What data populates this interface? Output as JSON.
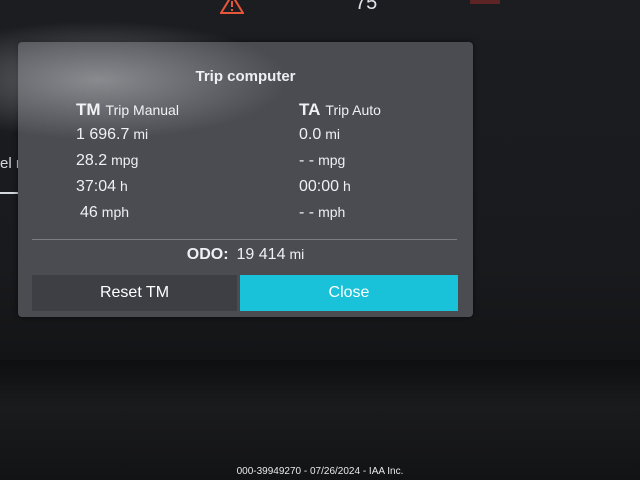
{
  "dashboard": {
    "top_number": "75",
    "side_text": "el ra"
  },
  "trip_computer": {
    "title": "Trip computer",
    "trip_manual": {
      "abbr": "TM",
      "label": "Trip Manual",
      "distance": {
        "value": "1 696.7",
        "unit": "mi"
      },
      "economy": {
        "value": "28.2",
        "unit": "mpg"
      },
      "time": {
        "value": "37:04",
        "unit": "h"
      },
      "speed": {
        "value": "46",
        "unit": "mph"
      }
    },
    "trip_auto": {
      "abbr": "TA",
      "label": "Trip Auto",
      "distance": {
        "value": "0.0",
        "unit": "mi"
      },
      "economy": {
        "value": "- -",
        "unit": "mpg"
      },
      "time": {
        "value": "00:00",
        "unit": "h"
      },
      "speed": {
        "value": "- -",
        "unit": "mph"
      }
    },
    "odometer": {
      "label": "ODO:",
      "value": "19 414",
      "unit": "mi"
    },
    "buttons": {
      "reset": "Reset TM",
      "close": "Close"
    }
  },
  "watermark": "000-39949270 - 07/26/2024 - IAA Inc.",
  "colors": {
    "popup_bg": "#4a4c52",
    "close_button": "#19c2d8",
    "reset_button": "#3d3f45",
    "warning": "#e8563a"
  }
}
